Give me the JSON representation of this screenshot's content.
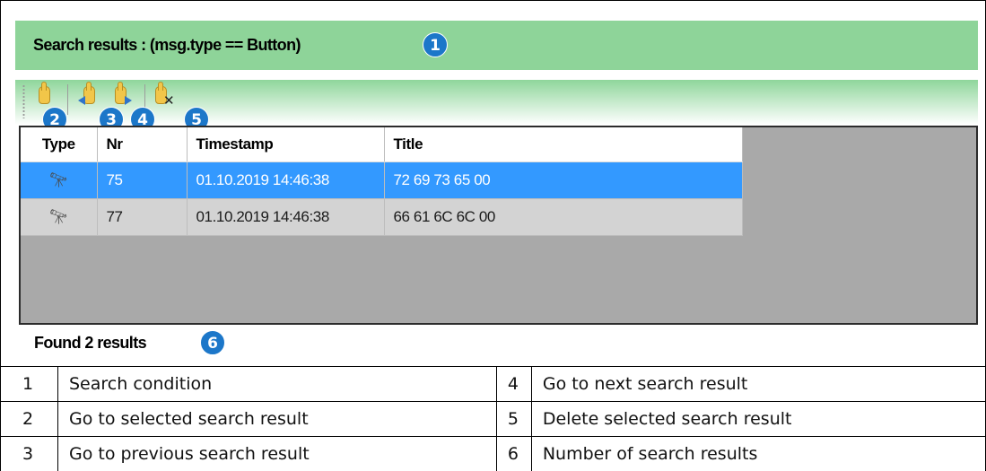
{
  "header": {
    "title": "Search results : (msg.type == Button)",
    "badge": "1"
  },
  "toolbar": {
    "buttons": [
      {
        "name": "go-to-selected",
        "badge": "2"
      },
      {
        "name": "go-to-previous",
        "badge": "3"
      },
      {
        "name": "go-to-next",
        "badge": "4"
      },
      {
        "name": "delete-selected",
        "badge": "5"
      }
    ]
  },
  "grid": {
    "columns": [
      "Type",
      "Nr",
      "Timestamp",
      "Title"
    ],
    "rows": [
      {
        "type_icon": "binoculars-icon",
        "nr": "75",
        "timestamp": "01.10.2019 14:46:38",
        "title": "72 69 73 65 00",
        "selected": true
      },
      {
        "type_icon": "binoculars-icon",
        "nr": "77",
        "timestamp": "01.10.2019 14:46:38",
        "title": "66 61 6C 6C 00",
        "selected": false
      }
    ]
  },
  "status": {
    "found_text": "Found 2 results",
    "badge": "6"
  },
  "legend": [
    {
      "n1": "1",
      "t1": "Search condition",
      "n2": "4",
      "t2": "Go to next search result"
    },
    {
      "n1": "2",
      "t1": "Go to selected search result",
      "n2": "5",
      "t2": "Delete selected search result"
    },
    {
      "n1": "3",
      "t1": "Go to previous search result",
      "n2": "6",
      "t2": "Number of search results"
    }
  ],
  "colors": {
    "header_green": "#8ed499",
    "selection_blue": "#3399ff",
    "badge_blue": "#1c77c9",
    "row_gray": "#d3d3d3",
    "grid_bg": "#a9a9a9"
  }
}
